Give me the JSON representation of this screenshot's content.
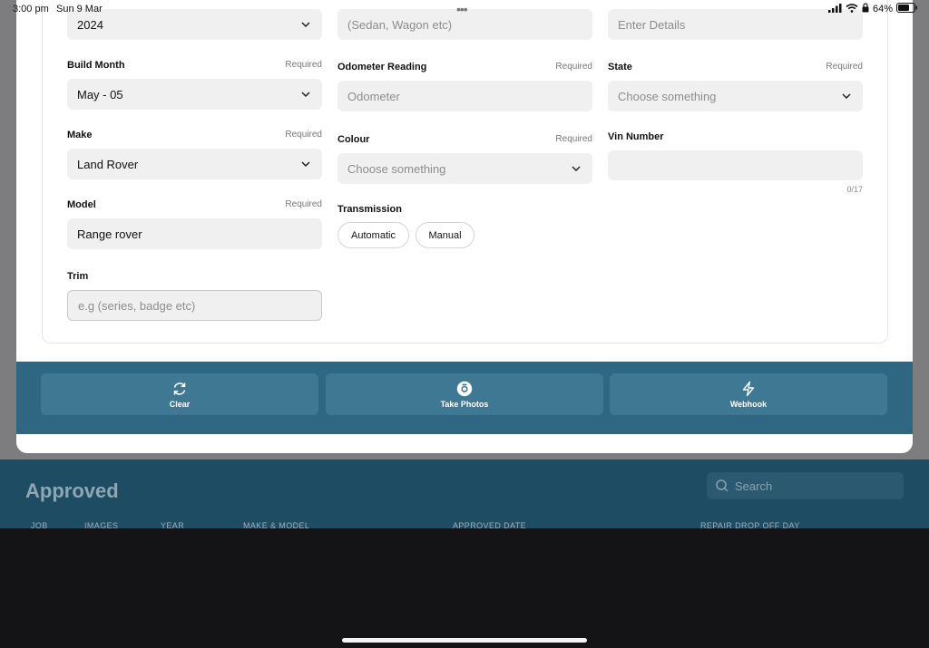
{
  "status_bar": {
    "time": "3:00 pm",
    "date": "Sun 9 Mar",
    "battery": "64%"
  },
  "form": {
    "year": {
      "value": "2024"
    },
    "body_type": {
      "placeholder": "(Sedan, Wagon etc)"
    },
    "details": {
      "placeholder": "Enter Details"
    },
    "build_month": {
      "label": "Build Month",
      "required": "Required",
      "value": "May - 05"
    },
    "odometer": {
      "label": "Odometer Reading",
      "required": "Required",
      "placeholder": "Odometer"
    },
    "state": {
      "label": "State",
      "required": "Required",
      "placeholder": "Choose something"
    },
    "make": {
      "label": "Make",
      "required": "Required",
      "value": "Land Rover"
    },
    "colour": {
      "label": "Colour",
      "required": "Required",
      "placeholder": "Choose something"
    },
    "vin": {
      "label": "Vin Number",
      "counter": "0/17"
    },
    "model": {
      "label": "Model",
      "required": "Required",
      "value": "Range rover"
    },
    "transmission": {
      "label": "Transmission",
      "options": [
        "Automatic",
        "Manual"
      ]
    },
    "trim": {
      "label": "Trim",
      "placeholder": "e.g (series, badge etc)"
    }
  },
  "actions": {
    "clear": "Clear",
    "take_photos": "Take Photos",
    "webhook": "Webhook"
  },
  "background": {
    "title": "Approved",
    "search_placeholder": "Search",
    "columns": [
      "JOB",
      "IMAGES",
      "YEAR",
      "MAKE & MODEL",
      "APPROVED DATE",
      "REPAIR DROP OFF DAY"
    ]
  },
  "colors": {
    "action_bar": "#2f6783",
    "action_button": "#3f7893",
    "bg_panel": "#1d4c63",
    "field_bg": "#f0f0f0"
  }
}
